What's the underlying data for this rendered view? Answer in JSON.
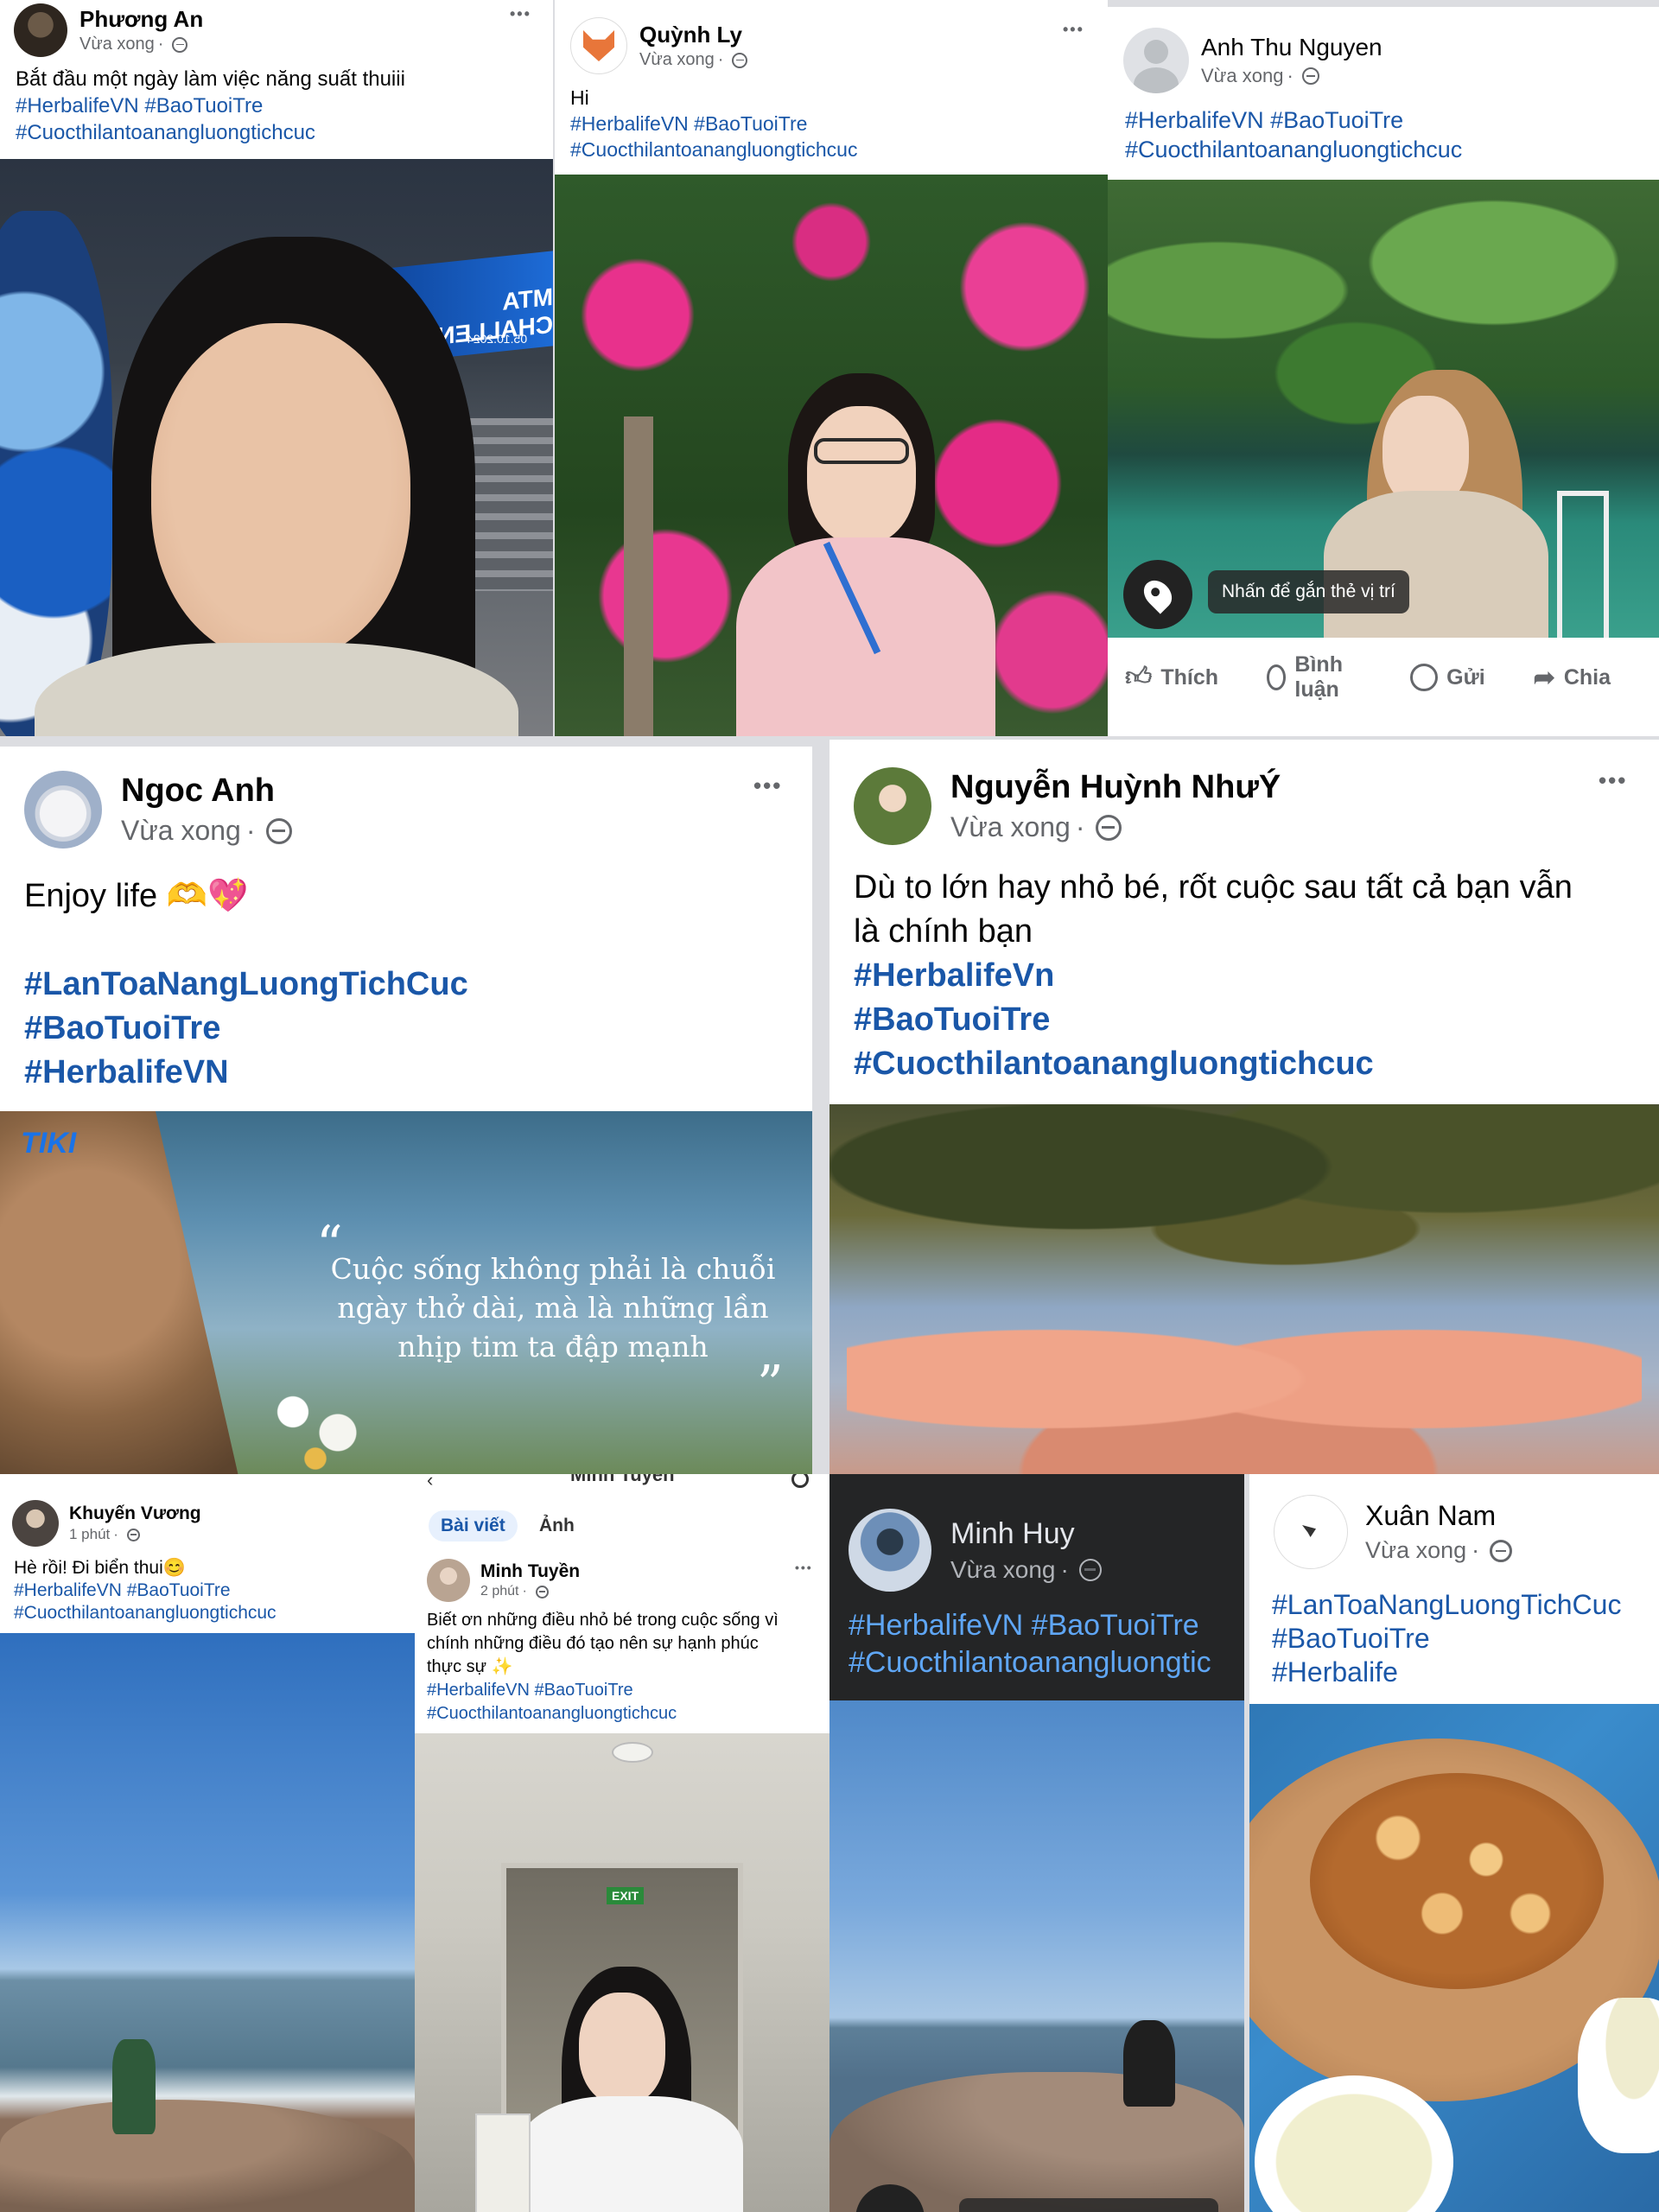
{
  "posts": {
    "phuong_an": {
      "name": "Phương An",
      "time": "Vừa xong",
      "more": "•••",
      "text": "Bắt đầu một ngày làm việc năng suất thuiii",
      "tags": [
        "#HerbalifeVN #BaoTuoiTre",
        "#Cuocthilantoanangluongtichcuc"
      ],
      "photo_text": [
        "MTA CHALLENGES",
        "05.10.2024"
      ]
    },
    "quynh_ly": {
      "name": "Quỳnh Ly",
      "time": "Vừa xong",
      "more": "•••",
      "text": "Hi",
      "tags": [
        "#HerbalifeVN #BaoTuoiTre",
        "#Cuocthilantoanangluongtichcuc"
      ]
    },
    "anh_thu": {
      "name": "Anh Thu Nguyen",
      "time": "Vừa xong",
      "tags": [
        "#HerbalifeVN #BaoTuoiTre",
        "#Cuocthilantoanangluongtichcuc"
      ],
      "location_hint": "Nhấn để gắn thẻ vị trí",
      "actions": {
        "like": "Thích",
        "comment": "Bình luận",
        "send": "Gửi",
        "share": "Chia"
      }
    },
    "ngoc_anh": {
      "name": "Ngoc Anh",
      "time": "Vừa xong",
      "more": "•••",
      "text": "Enjoy life 🫶💖",
      "tags": [
        "#LanToaNangLuongTichCuc",
        "#BaoTuoiTre",
        "#HerbalifeVN"
      ],
      "quote": [
        "Cuộc sống không phải là chuỗi",
        "ngày thở dài, mà là những lần",
        "nhịp tim ta đập mạnh"
      ],
      "logo": "TIKI"
    },
    "nguyen_huynh_nhuy": {
      "name": "Nguyễn Huỳnh NhưÝ",
      "time": "Vừa xong",
      "more": "•••",
      "text": [
        "Dù to lớn hay nhỏ bé, rốt cuộc sau tất cả bạn vẫn",
        "là chính bạn"
      ],
      "tags": [
        "#HerbalifeVn",
        "#BaoTuoiTre",
        "#Cuocthilantoanangluongtichcuc"
      ]
    },
    "khuyen_vuong": {
      "name": "Khuyến Vương",
      "time": "1 phút",
      "text": "Hè rồi! Đi biển thui😊",
      "tags": [
        "#HerbalifeVN #BaoTuoiTre",
        "#Cuocthilantoanangluongtichcuc"
      ]
    },
    "minh_tuyen": {
      "header_title": "Minh Tuyến",
      "tabs": [
        "Bài viết",
        "Ảnh"
      ],
      "name": "Minh Tuyền",
      "time": "2 phút",
      "more": "•••",
      "text": [
        "Biết ơn những điều nhỏ bé trong cuộc sống vì",
        "chính những điều đó tạo nên sự hạnh phúc",
        "thực sự ✨"
      ],
      "tags": [
        "#HerbalifeVN #BaoTuoiTre",
        "#Cuocthilantoanangluongtichcuc"
      ],
      "exit_sign": "EXIT"
    },
    "minh_huy": {
      "name": "Minh Huy",
      "time": "Vừa xong",
      "tags": [
        "#HerbalifeVN #BaoTuoiTre",
        "#Cuocthilantoanangluongtic"
      ]
    },
    "xuan_nam": {
      "name": "Xuân Nam",
      "time": "Vừa xong",
      "tags": [
        "#LanToaNangLuongTichCuc",
        "#BaoTuoiTre",
        "#Herbalife"
      ]
    }
  },
  "colors": {
    "hashtag": "#1a57a8",
    "hashtag_dark": "#5fa6f5",
    "card": "#ffffff",
    "dark_card": "#242526"
  }
}
